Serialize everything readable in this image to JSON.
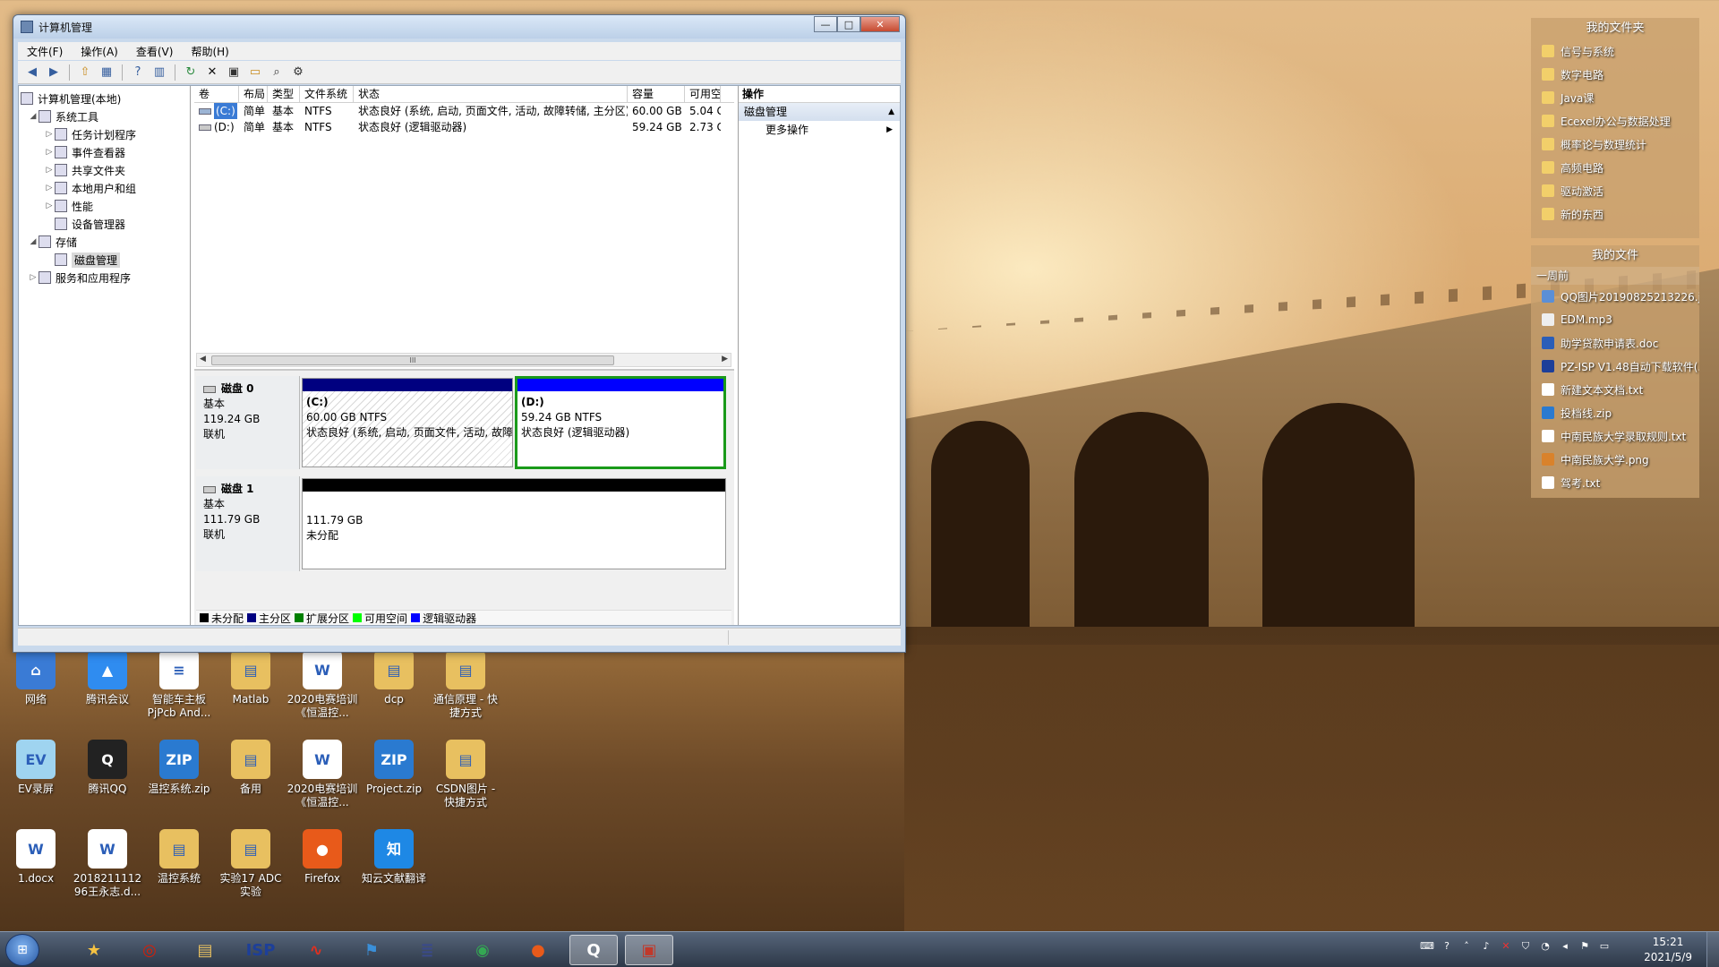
{
  "window": {
    "title": "计算机管理",
    "buttons": {
      "minimize": "—",
      "maximize": "□",
      "close": "✕"
    },
    "menu": [
      "文件(F)",
      "操作(A)",
      "查看(V)",
      "帮助(H)"
    ]
  },
  "tree": {
    "root": "计算机管理(本地)",
    "system_tools": "系统工具",
    "task_scheduler": "任务计划程序",
    "event_viewer": "事件查看器",
    "shared_folders": "共享文件夹",
    "local_users": "本地用户和组",
    "performance": "性能",
    "device_manager": "设备管理器",
    "storage": "存储",
    "disk_management": "磁盘管理",
    "services": "服务和应用程序"
  },
  "volume_table": {
    "headers": [
      "卷",
      "布局",
      "类型",
      "文件系统",
      "状态",
      "容量",
      "可用空"
    ],
    "rows": [
      [
        "(C:)",
        "简单",
        "基本",
        "NTFS",
        "状态良好 (系统, 启动, 页面文件, 活动, 故障转储, 主分区)",
        "60.00 GB",
        "5.04 G"
      ],
      [
        "(D:)",
        "简单",
        "基本",
        "NTFS",
        "状态良好 (逻辑驱动器)",
        "59.24 GB",
        "2.73 G"
      ]
    ],
    "scroll_thumb": "III"
  },
  "disks": [
    {
      "name": "磁盘 0",
      "type": "基本",
      "size": "119.24 GB",
      "status": "联机",
      "partitions": [
        {
          "label": "(C:)",
          "fs": "60.00 GB NTFS",
          "status": "状态良好 (系统, 启动, 页面文件, 活动, 故障转储, 主分区)"
        },
        {
          "label": "(D:)",
          "fs": "59.24 GB NTFS",
          "status": "状态良好 (逻辑驱动器)"
        }
      ]
    },
    {
      "name": "磁盘 1",
      "type": "基本",
      "size": "111.79 GB",
      "status": "联机",
      "partitions": [
        {
          "size": "111.79 GB",
          "status": "未分配"
        }
      ]
    }
  ],
  "legend": [
    {
      "label": "未分配",
      "color": "#000000"
    },
    {
      "label": "主分区",
      "color": "#000080"
    },
    {
      "label": "扩展分区",
      "color": "#008000"
    },
    {
      "label": "可用空间",
      "color": "#00ff00"
    },
    {
      "label": "逻辑驱动器",
      "color": "#0000ff"
    }
  ],
  "actions": {
    "header": "操作",
    "section": "磁盘管理",
    "more": "更多操作"
  },
  "desktop_icons": [
    {
      "label": "网络",
      "color": "#3a7bd5",
      "glyph": "⌂"
    },
    {
      "label": "腾讯会议",
      "color": "#2f8cf0",
      "glyph": "▲"
    },
    {
      "label": "智能车主板PjPcb And...",
      "color": "#ffffff",
      "glyph": "≡"
    },
    {
      "label": "Matlab",
      "color": "#e8c060",
      "glyph": "▤"
    },
    {
      "label": "2020电赛培训《恒温控...",
      "color": "#ffffff",
      "glyph": "W"
    },
    {
      "label": "dcp",
      "color": "#e8c060",
      "glyph": "▤"
    },
    {
      "label": "通信原理 - 快捷方式",
      "color": "#e8c060",
      "glyph": "▤"
    },
    {
      "label": "EV录屏",
      "color": "#9fd4f0",
      "glyph": "EV"
    },
    {
      "label": "腾讯QQ",
      "color": "#222222",
      "glyph": "Q"
    },
    {
      "label": "温控系统.zip",
      "color": "#2a7ad0",
      "glyph": "ZIP"
    },
    {
      "label": "备用",
      "color": "#e8c060",
      "glyph": "▤"
    },
    {
      "label": "2020电赛培训《恒温控...",
      "color": "#ffffff",
      "glyph": "W"
    },
    {
      "label": "Project.zip",
      "color": "#2a7ad0",
      "glyph": "ZIP"
    },
    {
      "label": "CSDN图片 - 快捷方式",
      "color": "#e8c060",
      "glyph": "▤"
    },
    {
      "label": "1.docx",
      "color": "#ffffff",
      "glyph": "W"
    },
    {
      "label": "2018211112 96王永志.d...",
      "color": "#ffffff",
      "glyph": "W"
    },
    {
      "label": "温控系统",
      "color": "#e8c060",
      "glyph": "▤"
    },
    {
      "label": "实验17 ADC实验",
      "color": "#e8c060",
      "glyph": "▤"
    },
    {
      "label": "Firefox",
      "color": "#e85a1a",
      "glyph": "●"
    },
    {
      "label": "知云文献翻译",
      "color": "#1e88e5",
      "glyph": "知"
    }
  ],
  "fence_folders": {
    "title": "我的文件夹",
    "items": [
      "信号与系统",
      "数字电路",
      "Java课",
      "Ecexel办公与数据处理",
      "概率论与数理统计",
      "高频电路",
      "驱动激活",
      "新的东西"
    ]
  },
  "fence_files": {
    "title": "我的文件",
    "group": "一周前",
    "items": [
      {
        "name": "QQ图片20190825213226.jpg",
        "color": "#5b8fd6"
      },
      {
        "name": "EDM.mp3",
        "color": "#eeeeee"
      },
      {
        "name": "助学贷款申请表.doc",
        "color": "#2b5eb8"
      },
      {
        "name": "PZ-ISP V1.48自动下载软件(...",
        "color": "#1d3f99"
      },
      {
        "name": "新建文本文档.txt",
        "color": "#ffffff"
      },
      {
        "name": "投档线.zip",
        "color": "#2a7ad0"
      },
      {
        "name": "中南民族大学录取规则.txt",
        "color": "#ffffff"
      },
      {
        "name": "中南民族大学.png",
        "color": "#d9822b"
      },
      {
        "name": "驾考.txt",
        "color": "#ffffff"
      }
    ]
  },
  "taskbar": {
    "items": [
      {
        "name": "star-app",
        "glyph": "★",
        "color": "#f5c242"
      },
      {
        "name": "netease-music",
        "glyph": "◎",
        "color": "#d81e06"
      },
      {
        "name": "file-explorer",
        "glyph": "▤",
        "color": "#e8c060"
      },
      {
        "name": "isp-tool",
        "glyph": "ISP",
        "color": "#1d3f99"
      },
      {
        "name": "waveform-app",
        "glyph": "∿",
        "color": "#e03020"
      },
      {
        "name": "bird-app",
        "glyph": "⚑",
        "color": "#3a8fd8"
      },
      {
        "name": "keil-app",
        "glyph": "≣",
        "color": "#3a4a8a"
      },
      {
        "name": "chrome",
        "glyph": "◉",
        "color": "#34a853"
      },
      {
        "name": "firefox",
        "glyph": "●",
        "color": "#e85a1a"
      },
      {
        "name": "qq",
        "glyph": "Q",
        "color": "#ffffff"
      },
      {
        "name": "computer-management",
        "glyph": "▣",
        "color": "#c0392b"
      }
    ],
    "time": "15:21",
    "date": "2021/5/9"
  }
}
